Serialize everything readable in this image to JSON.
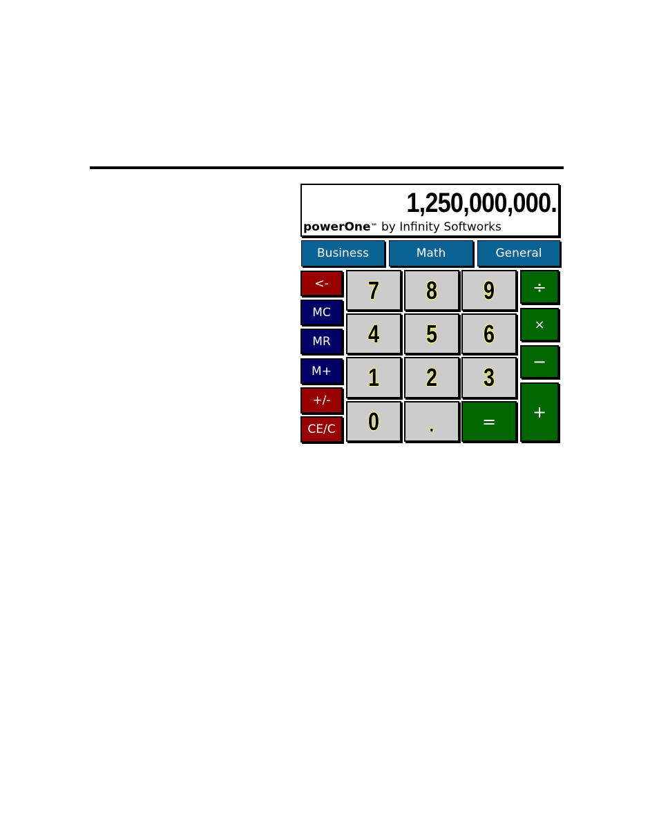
{
  "display": {
    "value": "1,250,000,000.",
    "brand_name": "powerOne",
    "brand_tm": "™",
    "brand_by": "by Infinity Softworks"
  },
  "tabs": [
    {
      "label": "Business"
    },
    {
      "label": "Math"
    },
    {
      "label": "General"
    }
  ],
  "side_keys": [
    {
      "label": "<-",
      "name": "backspace"
    },
    {
      "label": "MC",
      "name": "memory-clear"
    },
    {
      "label": "MR",
      "name": "memory-recall"
    },
    {
      "label": "M+",
      "name": "memory-add"
    },
    {
      "label": "+/-",
      "name": "sign-toggle"
    },
    {
      "label": "CE/C",
      "name": "clear-entry"
    }
  ],
  "digit_keys": {
    "seven": "7",
    "eight": "8",
    "nine": "9",
    "four": "4",
    "five": "5",
    "six": "6",
    "one": "1",
    "two": "2",
    "three": "3",
    "zero": "0",
    "decimal": "."
  },
  "op_keys": {
    "divide": "÷",
    "multiply": "×",
    "subtract": "−",
    "add": "+",
    "equals": "="
  },
  "colors": {
    "tab_blue": "#0a6394",
    "memory_navy": "#000066",
    "clear_red": "#990000",
    "operator_green": "#006600",
    "digit_grey": "#cccccc",
    "digit_outline_yellow": "#ffff66"
  }
}
